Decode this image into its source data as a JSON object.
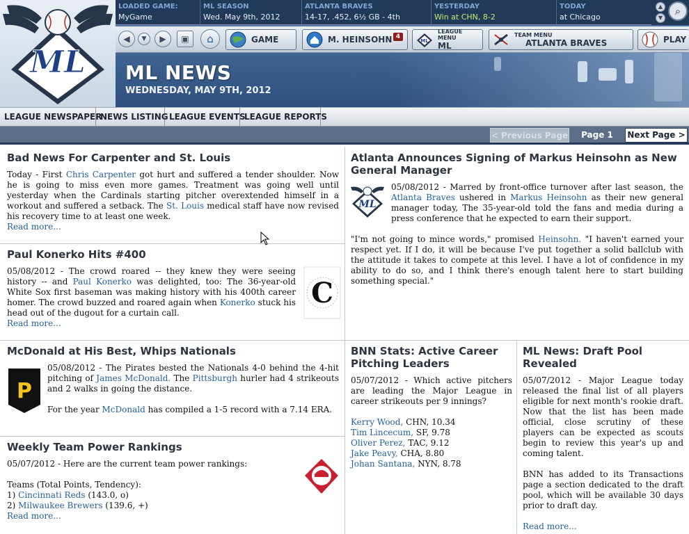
{
  "info_bar": {
    "loaded_game": {
      "label": "LOADED GAME:",
      "value": "MyGame"
    },
    "season": {
      "label": "ML SEASON",
      "value": "Wed. May 9th, 2012"
    },
    "team": {
      "label": "ATLANTA BRAVES",
      "value": "14-17, .452, 6½ GB - 4th"
    },
    "yesterday": {
      "label": "YESTERDAY",
      "value": "Win at CHN, 8-2"
    },
    "today": {
      "label": "TODAY",
      "value": "at Chicago"
    }
  },
  "nav": {
    "game_label": "GAME",
    "manager_label": "M. HEINSOHN",
    "manager_badge": "4",
    "league_menu_small": "LEAGUE MENU",
    "league_menu_label": "ML",
    "team_menu_small": "TEAM MENU",
    "team_menu_label": "ATLANTA BRAVES",
    "play_label": "PLAY"
  },
  "header": {
    "title": "ML NEWS",
    "date": "WEDNESDAY, MAY 9TH, 2012",
    "logo_text": "ML"
  },
  "tabs": [
    "LEAGUE NEWSPAPER",
    "NEWS LISTING",
    "LEAGUE EVENTS",
    "LEAGUE REPORTS"
  ],
  "pager": {
    "prev": "< Previous Page",
    "current": "Page 1",
    "next": "Next Page >"
  },
  "articles": {
    "carpenter": {
      "headline": "Bad News For Carpenter and St. Louis",
      "p1": "Today - First ",
      "l1": "Chris Carpenter",
      "p2": " got hurt and suffered a tender shoulder. Now he is going to miss even more games. Treatment was going well until yesterday when the Cardinals starting pitcher overextended himself in a workout and suffered a setback. The ",
      "l2": "St. Louis",
      "p3": " medical staff have now revised his recovery time to at least one week.",
      "more": "Read more..."
    },
    "konerko": {
      "headline": "Paul Konerko Hits #400",
      "p1": "05/08/2012 - The crowd roared -- they knew they were seeing history -- and ",
      "l1": "Paul Konerko",
      "p2": " was delighted, too: The 36-year-old White Sox first baseman was making history with his 400th career homer. The crowd buzzed and roared again when ",
      "l2": "Konerko",
      "p3": " stuck his head out of the dugout for a curtain call.",
      "more": "Read more..."
    },
    "heinsohn": {
      "headline": "Atlanta Announces Signing of Markus Heinsohn as New General Manager",
      "p1": "05/08/2012 - Marred by front-office turnover after last season, the ",
      "l1": "Atlanta Braves",
      "p2": " ushered in ",
      "l2": "Markus Heinsohn",
      "p3": " as their new general manager today, The 35-year-old told the fans and media during a press conference that he expected to earn their support.",
      "q1": "\"I'm not going to mince words,\" promised ",
      "ql": "Heinsohn.",
      "q2": " \"I haven't earned your respect yet. If I do, it will be because I've put together a solid ballclub with the attitude it takes to compete at this level. I have a lot of confidence in my ability to do so, and I think there's enough talent here to start building something special.\""
    },
    "mcdonald": {
      "headline": "McDonald at His Best, Whips Nationals",
      "p1": "05/08/2012 - The Pirates bested the Nationals 4-0 behind the 4-hit pitching of ",
      "l1": "James McDonald.",
      "p2": " The ",
      "l2": "Pittsburgh",
      "p3": " hurler had 4 strikeouts and 2 walks in going the distance.",
      "q1": "For the year ",
      "ql": "McDonald",
      "q2": " has compiled a 1-5 record with a 7.14 ERA."
    },
    "power": {
      "headline": "Weekly Team Power Rankings",
      "intro": "05/07/2012 - Here are the current team power rankings:",
      "teams_label": "Teams (Total Points, Tendency):",
      "rows": [
        {
          "prefix": "1) ",
          "team": "Cincinnati Reds",
          "stats": " (143.0, o)"
        },
        {
          "prefix": "2) ",
          "team": "Milwaukee Brewers",
          "stats": " (139.6, +)"
        }
      ],
      "more": "Read more..."
    },
    "bnn": {
      "headline": "BNN Stats: Active Career Pitching Leaders",
      "intro": "05/07/2012 - Which active pitchers are leading the Major League in career strikeouts per 9 innings?",
      "rows": [
        {
          "name": "Kerry Wood,",
          "stats": " CHN, 10.34"
        },
        {
          "name": "Tim Lincecum,",
          "stats": " SF, 9.78"
        },
        {
          "name": "Oliver Perez,",
          "stats": " TAC, 9.12"
        },
        {
          "name": "Jake Peavy,",
          "stats": " CHA, 8.80"
        },
        {
          "name": "Johan Santana,",
          "stats": " NYN, 8.78"
        }
      ]
    },
    "draft": {
      "headline": "ML News: Draft Pool Revealed",
      "p1": "05/07/2012 - Major League today released the final list of all players eligible for next month's rookie draft. Now that the list has been made official, close scrutiny of these players can be expected as scouts begin to review this year's up and coming talent.",
      "p2": "BNN has added to its Transactions page a section dedicated to the draft pool, which will be available 30 days prior to draft day.",
      "more": "Read more..."
    }
  },
  "colors": {
    "link": "#24609a",
    "header_dark": "#223a5a",
    "info_label": "#7fa6d6",
    "win": "#c9e86a"
  },
  "icons": [
    "back-arrow-icon",
    "dropdown-arrow-icon",
    "forward-arrow-icon",
    "bookmark-icon",
    "home-icon",
    "globe-icon",
    "search-icon",
    "baseball-icon",
    "league-logo-icon"
  ]
}
